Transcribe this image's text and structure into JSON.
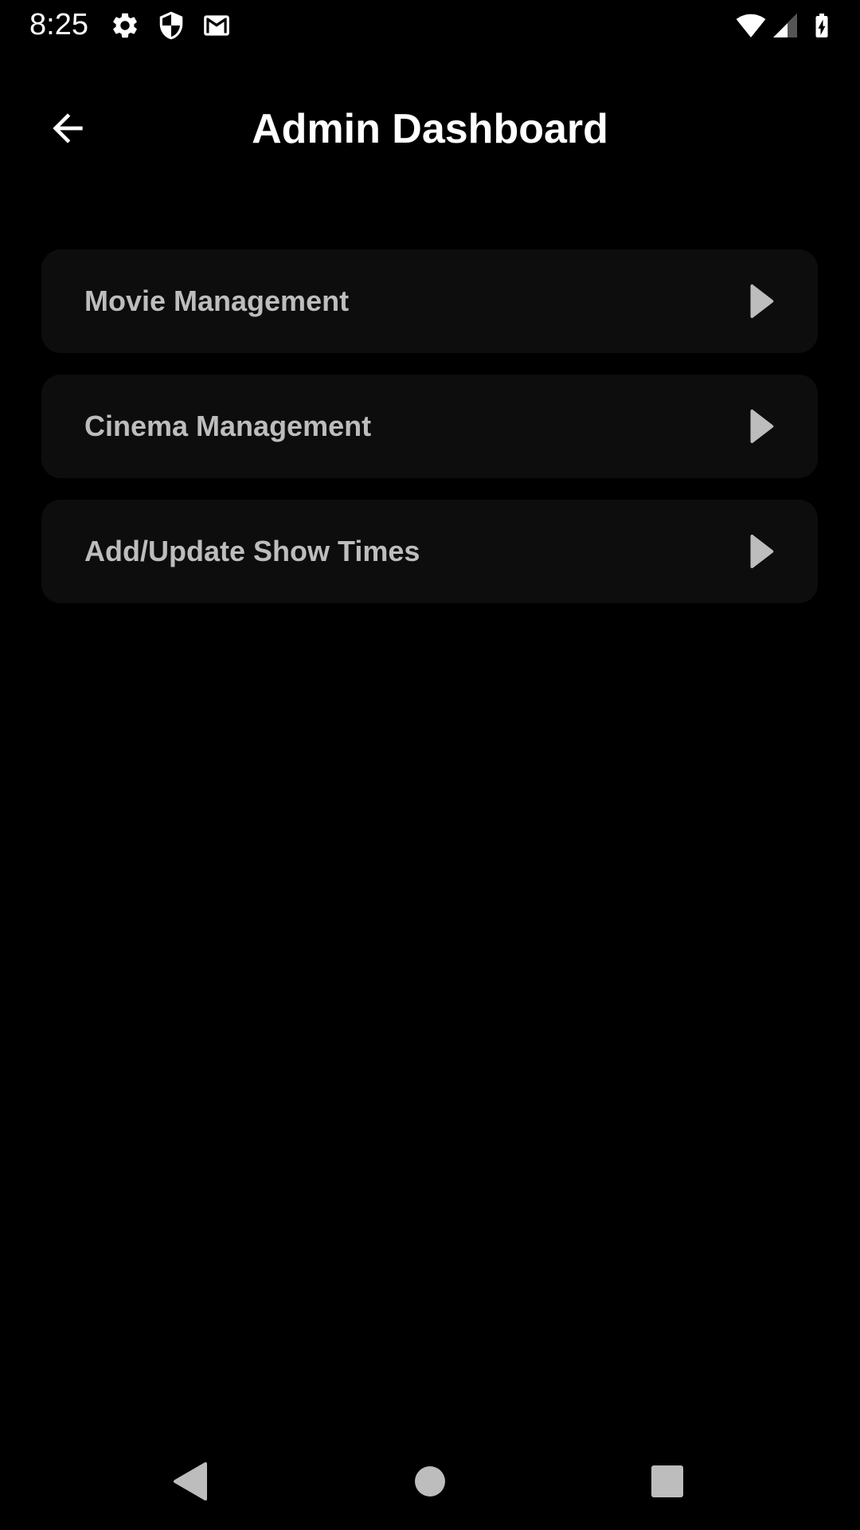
{
  "status_bar": {
    "time": "8:25",
    "left_icons": [
      "gear-icon",
      "shield-icon",
      "gmail-icon"
    ],
    "right_icons": [
      "wifi-icon",
      "signal-icon",
      "battery-charging-icon"
    ]
  },
  "header": {
    "title": "Admin Dashboard",
    "back_icon": "arrow-left-icon"
  },
  "menu": {
    "items": [
      {
        "label": "Movie Management",
        "icon": "play-arrow-icon"
      },
      {
        "label": "Cinema Management",
        "icon": "play-arrow-icon"
      },
      {
        "label": "Add/Update Show Times",
        "icon": "play-arrow-icon"
      }
    ]
  },
  "nav_bar": {
    "icons": [
      "nav-back-icon",
      "nav-home-icon",
      "nav-recents-icon"
    ]
  },
  "colors": {
    "background": "#000000",
    "card": "#0d0d0d",
    "text_primary": "#ffffff",
    "text_secondary": "#bdbdbd",
    "nav_icon": "#bdbdbd"
  }
}
